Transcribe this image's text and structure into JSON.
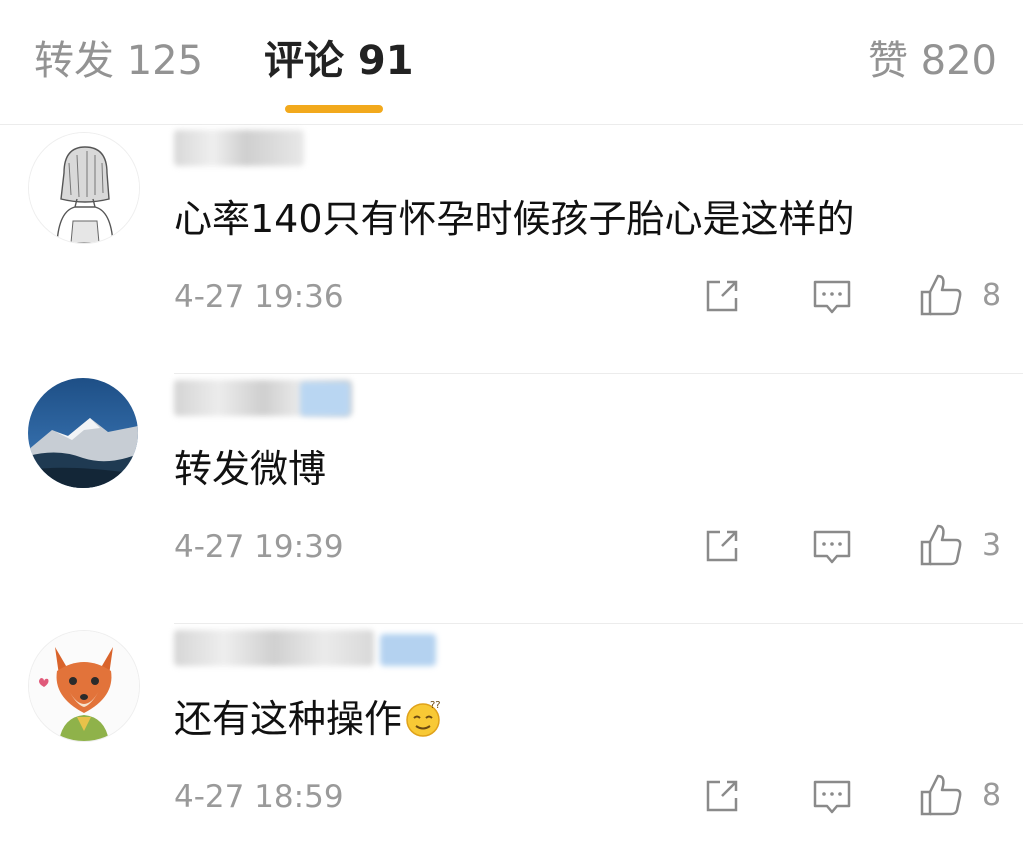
{
  "tabs": {
    "repost": "转发 125",
    "comment": "评论 91",
    "like": "赞 820"
  },
  "comments": [
    {
      "text": "心率140只有怀孕时候孩子胎心是这样的",
      "time": "4-27 19:36",
      "likes": "8",
      "avatar": "girl-sketch-avatar"
    },
    {
      "text": "转发微博",
      "time": "4-27 19:39",
      "likes": "3",
      "avatar": "mountain-landscape-avatar"
    },
    {
      "text": "还有这种操作",
      "time": "4-27 18:59",
      "likes": "8",
      "avatar": "fox-cartoon-avatar",
      "emoji": "confused-emoji"
    }
  ],
  "colors": {
    "accent": "#f2a91c",
    "text": "#111111",
    "muted": "#9a9a9a",
    "tab_inactive": "#939393"
  }
}
